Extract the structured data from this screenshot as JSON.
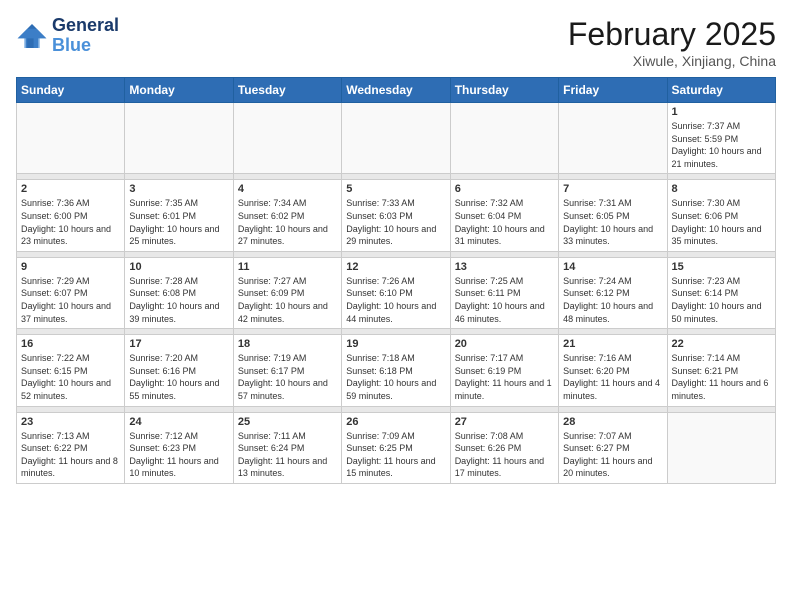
{
  "logo": {
    "line1": "General",
    "line2": "Blue"
  },
  "title": "February 2025",
  "location": "Xiwule, Xinjiang, China",
  "weekdays": [
    "Sunday",
    "Monday",
    "Tuesday",
    "Wednesday",
    "Thursday",
    "Friday",
    "Saturday"
  ],
  "weeks": [
    [
      {
        "day": "",
        "info": ""
      },
      {
        "day": "",
        "info": ""
      },
      {
        "day": "",
        "info": ""
      },
      {
        "day": "",
        "info": ""
      },
      {
        "day": "",
        "info": ""
      },
      {
        "day": "",
        "info": ""
      },
      {
        "day": "1",
        "info": "Sunrise: 7:37 AM\nSunset: 5:59 PM\nDaylight: 10 hours and 21 minutes."
      }
    ],
    [
      {
        "day": "2",
        "info": "Sunrise: 7:36 AM\nSunset: 6:00 PM\nDaylight: 10 hours and 23 minutes."
      },
      {
        "day": "3",
        "info": "Sunrise: 7:35 AM\nSunset: 6:01 PM\nDaylight: 10 hours and 25 minutes."
      },
      {
        "day": "4",
        "info": "Sunrise: 7:34 AM\nSunset: 6:02 PM\nDaylight: 10 hours and 27 minutes."
      },
      {
        "day": "5",
        "info": "Sunrise: 7:33 AM\nSunset: 6:03 PM\nDaylight: 10 hours and 29 minutes."
      },
      {
        "day": "6",
        "info": "Sunrise: 7:32 AM\nSunset: 6:04 PM\nDaylight: 10 hours and 31 minutes."
      },
      {
        "day": "7",
        "info": "Sunrise: 7:31 AM\nSunset: 6:05 PM\nDaylight: 10 hours and 33 minutes."
      },
      {
        "day": "8",
        "info": "Sunrise: 7:30 AM\nSunset: 6:06 PM\nDaylight: 10 hours and 35 minutes."
      }
    ],
    [
      {
        "day": "9",
        "info": "Sunrise: 7:29 AM\nSunset: 6:07 PM\nDaylight: 10 hours and 37 minutes."
      },
      {
        "day": "10",
        "info": "Sunrise: 7:28 AM\nSunset: 6:08 PM\nDaylight: 10 hours and 39 minutes."
      },
      {
        "day": "11",
        "info": "Sunrise: 7:27 AM\nSunset: 6:09 PM\nDaylight: 10 hours and 42 minutes."
      },
      {
        "day": "12",
        "info": "Sunrise: 7:26 AM\nSunset: 6:10 PM\nDaylight: 10 hours and 44 minutes."
      },
      {
        "day": "13",
        "info": "Sunrise: 7:25 AM\nSunset: 6:11 PM\nDaylight: 10 hours and 46 minutes."
      },
      {
        "day": "14",
        "info": "Sunrise: 7:24 AM\nSunset: 6:12 PM\nDaylight: 10 hours and 48 minutes."
      },
      {
        "day": "15",
        "info": "Sunrise: 7:23 AM\nSunset: 6:14 PM\nDaylight: 10 hours and 50 minutes."
      }
    ],
    [
      {
        "day": "16",
        "info": "Sunrise: 7:22 AM\nSunset: 6:15 PM\nDaylight: 10 hours and 52 minutes."
      },
      {
        "day": "17",
        "info": "Sunrise: 7:20 AM\nSunset: 6:16 PM\nDaylight: 10 hours and 55 minutes."
      },
      {
        "day": "18",
        "info": "Sunrise: 7:19 AM\nSunset: 6:17 PM\nDaylight: 10 hours and 57 minutes."
      },
      {
        "day": "19",
        "info": "Sunrise: 7:18 AM\nSunset: 6:18 PM\nDaylight: 10 hours and 59 minutes."
      },
      {
        "day": "20",
        "info": "Sunrise: 7:17 AM\nSunset: 6:19 PM\nDaylight: 11 hours and 1 minute."
      },
      {
        "day": "21",
        "info": "Sunrise: 7:16 AM\nSunset: 6:20 PM\nDaylight: 11 hours and 4 minutes."
      },
      {
        "day": "22",
        "info": "Sunrise: 7:14 AM\nSunset: 6:21 PM\nDaylight: 11 hours and 6 minutes."
      }
    ],
    [
      {
        "day": "23",
        "info": "Sunrise: 7:13 AM\nSunset: 6:22 PM\nDaylight: 11 hours and 8 minutes."
      },
      {
        "day": "24",
        "info": "Sunrise: 7:12 AM\nSunset: 6:23 PM\nDaylight: 11 hours and 10 minutes."
      },
      {
        "day": "25",
        "info": "Sunrise: 7:11 AM\nSunset: 6:24 PM\nDaylight: 11 hours and 13 minutes."
      },
      {
        "day": "26",
        "info": "Sunrise: 7:09 AM\nSunset: 6:25 PM\nDaylight: 11 hours and 15 minutes."
      },
      {
        "day": "27",
        "info": "Sunrise: 7:08 AM\nSunset: 6:26 PM\nDaylight: 11 hours and 17 minutes."
      },
      {
        "day": "28",
        "info": "Sunrise: 7:07 AM\nSunset: 6:27 PM\nDaylight: 11 hours and 20 minutes."
      },
      {
        "day": "",
        "info": ""
      }
    ]
  ]
}
